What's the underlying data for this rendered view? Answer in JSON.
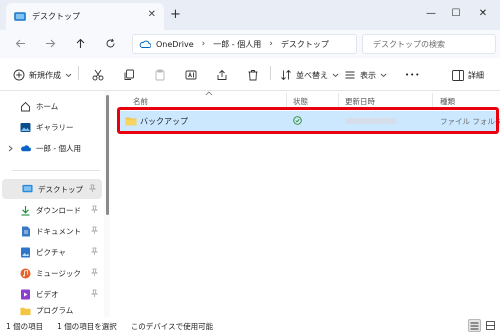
{
  "window": {
    "tab_title": "デスクトップ",
    "tab_close": "✕",
    "new_tab": "+",
    "minimize": "—",
    "maximize": "☐",
    "close": "✕"
  },
  "address": {
    "breadcrumbs": [
      "OneDrive",
      "一郎 - 個人用",
      "デスクトップ"
    ],
    "separator": "›",
    "search_placeholder": "デスクトップの検索"
  },
  "toolbar": {
    "new_label": "新規作成",
    "sort_label": "並べ替え",
    "view_label": "表示",
    "more_label": "•••",
    "details_label": "詳細"
  },
  "nav": {
    "top_items": [
      {
        "label": "ホーム",
        "icon": "home-icon"
      },
      {
        "label": "ギャラリー",
        "icon": "gallery-icon"
      },
      {
        "label": "一郎 - 個人用",
        "icon": "onedrive-icon"
      }
    ],
    "quick_access": [
      {
        "label": "デスクトップ",
        "icon": "desktop-icon",
        "selected": true
      },
      {
        "label": "ダウンロード",
        "icon": "download-icon"
      },
      {
        "label": "ドキュメント",
        "icon": "document-icon"
      },
      {
        "label": "ピクチャ",
        "icon": "pictures-icon"
      },
      {
        "label": "ミュージック",
        "icon": "music-icon"
      },
      {
        "label": "ビデオ",
        "icon": "video-icon"
      },
      {
        "label": "プログラム",
        "icon": "folder-icon"
      }
    ]
  },
  "columns": {
    "name": "名前",
    "status": "状態",
    "modified": "更新日時",
    "type": "種類"
  },
  "files": [
    {
      "name": "バックアップ",
      "status_icon": "sync-ok-icon",
      "type": "ファイル フォルダー"
    }
  ],
  "status_bar": {
    "item_count": "1 個の項目",
    "selected": "1 個の項目を選択",
    "availability": "このデバイスで使用可能"
  },
  "colors": {
    "selection": "#cce8ff",
    "highlight_border": "#e8000c",
    "accent": "#0067c0",
    "folder": "#f4c542"
  }
}
